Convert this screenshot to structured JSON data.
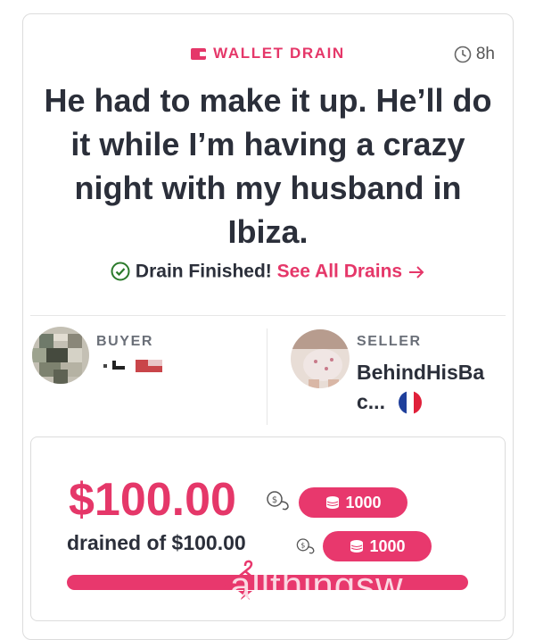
{
  "header": {
    "tag_label": "WALLET DRAIN",
    "time_ago": "8h"
  },
  "headline": "He had to make it up. He’ll do it while I’m having a crazy night with my husband in Ibiza.",
  "status": {
    "finished_text": "Drain Finished!",
    "see_all_link": "See All Drains"
  },
  "buyer": {
    "role_label": "BUYER"
  },
  "seller": {
    "role_label": "SELLER",
    "name_line1": "BehindHisBa",
    "name_line2": "c..."
  },
  "wallet": {
    "amount": "$100.00",
    "amount_tokens": "1000",
    "drained_text": "drained of $100.00",
    "drained_tokens": "1000",
    "progress": 1.0
  },
  "watermark": "allthingsw",
  "colors": {
    "accent": "#e53769",
    "text": "#2b2f3a",
    "success": "#2b2f3a"
  }
}
